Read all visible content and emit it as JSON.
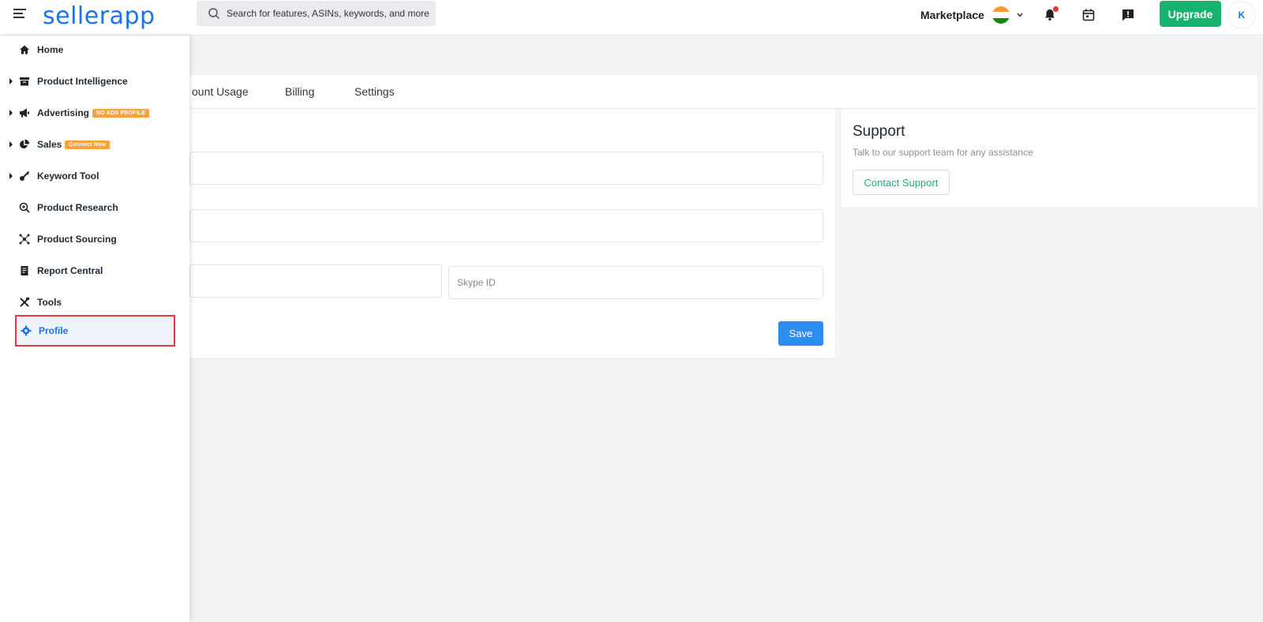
{
  "header": {
    "logo_text_1": "seller",
    "logo_text_2": "app",
    "search_placeholder": "Search for features, ASINs, keywords, and more",
    "marketplace_label": "Marketplace",
    "upgrade_label": "Upgrade",
    "avatar_initial": "K"
  },
  "sidebar": {
    "items": [
      {
        "label": "Home",
        "icon": "home-icon"
      },
      {
        "label": "Product Intelligence",
        "icon": "archive-icon"
      },
      {
        "label": "Advertising",
        "icon": "megaphone-icon",
        "badge": "NO ADS PROFILE"
      },
      {
        "label": "Sales",
        "icon": "pie-chart-icon",
        "badge": "Connect Now"
      },
      {
        "label": "Keyword Tool",
        "icon": "key-icon"
      },
      {
        "label": "Product Research",
        "icon": "search-plus-icon"
      },
      {
        "label": "Product Sourcing",
        "icon": "network-icon"
      },
      {
        "label": "Report Central",
        "icon": "report-icon"
      },
      {
        "label": "Tools",
        "icon": "tools-icon"
      },
      {
        "label": "Profile",
        "icon": "gear-icon"
      }
    ]
  },
  "tabs": [
    "ount Usage",
    "Billing",
    "Settings"
  ],
  "form": {
    "skype_placeholder": "Skype ID",
    "save_label": "Save"
  },
  "support": {
    "title": "Support",
    "subtitle": "Talk to our support team for any assistance",
    "button_label": "Contact Support"
  },
  "colors": {
    "brand": "#1a73e8",
    "upgrade": "#16b36e",
    "badge": "#f7a23b",
    "highlight": "#e53935"
  }
}
